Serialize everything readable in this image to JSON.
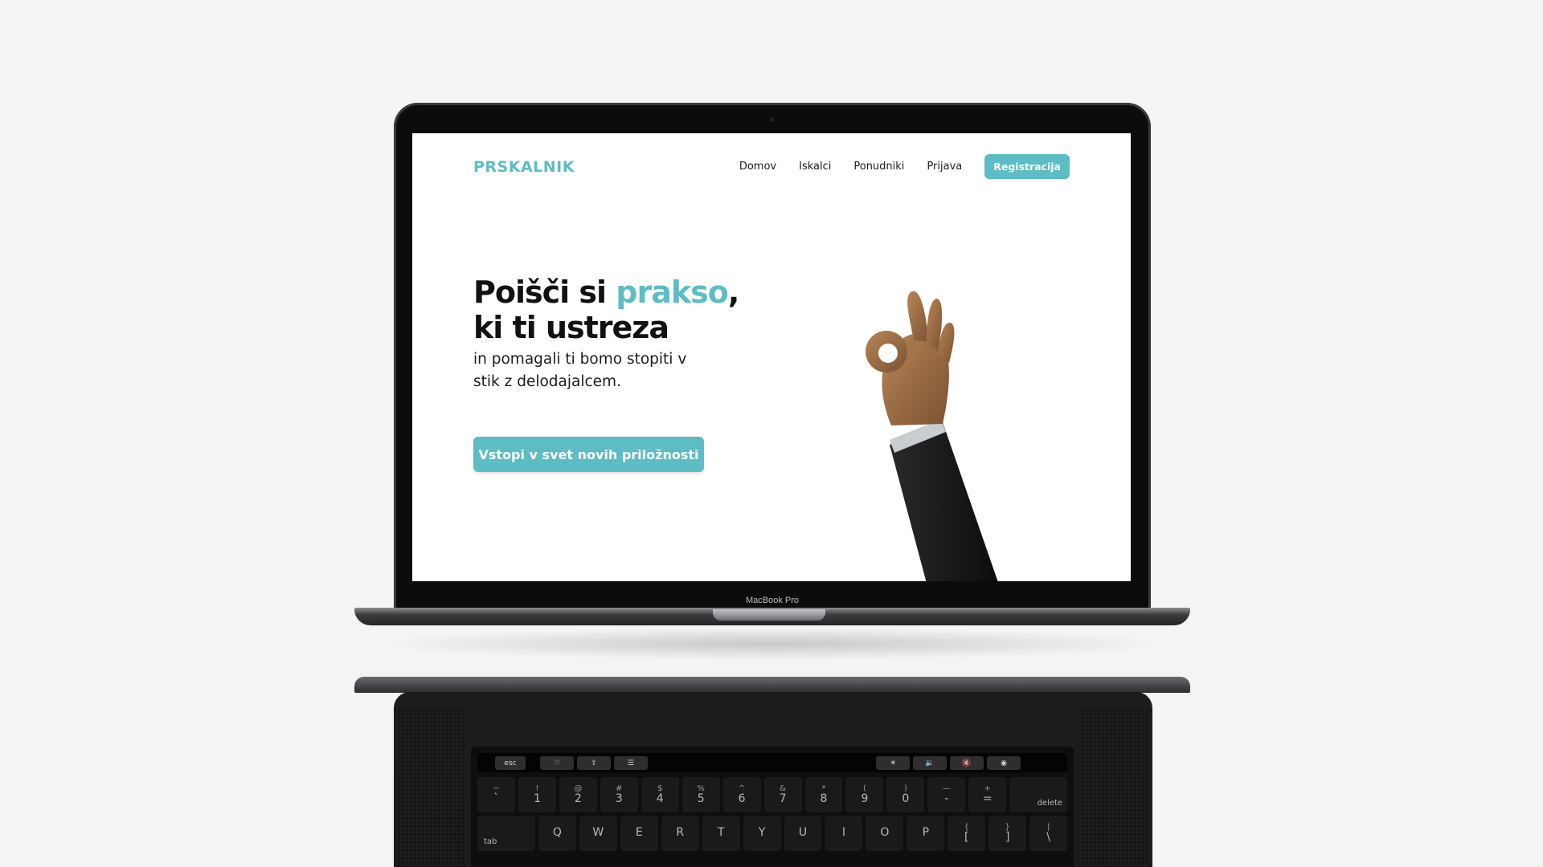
{
  "device": {
    "model_label": "MacBook Pro"
  },
  "site": {
    "logo": "PRSKALNIK",
    "nav": [
      {
        "label": "Domov"
      },
      {
        "label": "Iskalci"
      },
      {
        "label": "Ponudniki"
      },
      {
        "label": "Prijava"
      }
    ],
    "register_label": "Registracija",
    "hero": {
      "title_pre": "Poišči si ",
      "title_accent": "prakso",
      "title_post": ",",
      "title_line2": "ki ti ustreza",
      "subtitle": "in pomagali ti bomo stopiti v stik z delodajalcem.",
      "cta_label": "Vstopi v svet novih priložnosti"
    },
    "accent_color": "#5ebcc4"
  },
  "keyboard": {
    "touchbar": [
      "esc"
    ],
    "number_row": [
      {
        "top": "~",
        "main": "`"
      },
      {
        "top": "!",
        "main": "1"
      },
      {
        "top": "@",
        "main": "2"
      },
      {
        "top": "#",
        "main": "3"
      },
      {
        "top": "$",
        "main": "4"
      },
      {
        "top": "%",
        "main": "5"
      },
      {
        "top": "^",
        "main": "6"
      },
      {
        "top": "&",
        "main": "7"
      },
      {
        "top": "*",
        "main": "8"
      },
      {
        "top": "(",
        "main": "9"
      },
      {
        "top": ")",
        "main": "0"
      },
      {
        "top": "—",
        "main": "-"
      },
      {
        "top": "+",
        "main": "="
      }
    ],
    "delete_label": "delete",
    "tab_label": "tab",
    "qwerty_row": [
      "Q",
      "W",
      "E",
      "R",
      "T",
      "Y",
      "U",
      "I",
      "O",
      "P"
    ],
    "bracket_keys": [
      {
        "top": "{",
        "main": "["
      },
      {
        "top": "}",
        "main": "]"
      },
      {
        "top": "|",
        "main": "\\"
      }
    ]
  }
}
